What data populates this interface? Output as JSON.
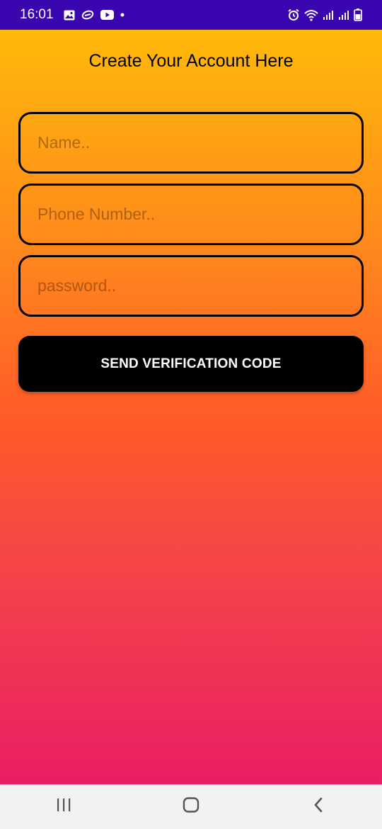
{
  "status_bar": {
    "time": "16:01",
    "background_color": "#3a06b0",
    "left_icons": [
      "gallery-icon",
      "link-icon",
      "youtube-icon",
      "dot-icon"
    ],
    "right_icons": [
      "alarm-icon",
      "wifi-icon",
      "signal-icon",
      "signal-icon",
      "battery-icon"
    ]
  },
  "form": {
    "title": "Create Your Account Here",
    "name_placeholder": "Name..",
    "phone_placeholder": "Phone Number..",
    "password_placeholder": "password..",
    "send_button_label": "SEND VERIFICATION CODE"
  },
  "colors": {
    "gradient_top": "#ffb90a",
    "gradient_middle": "#ff5a28",
    "gradient_bottom": "#e91e63",
    "button": "#000000"
  },
  "nav_bar": {
    "icons": [
      "recent-apps-icon",
      "home-icon",
      "back-icon"
    ]
  }
}
